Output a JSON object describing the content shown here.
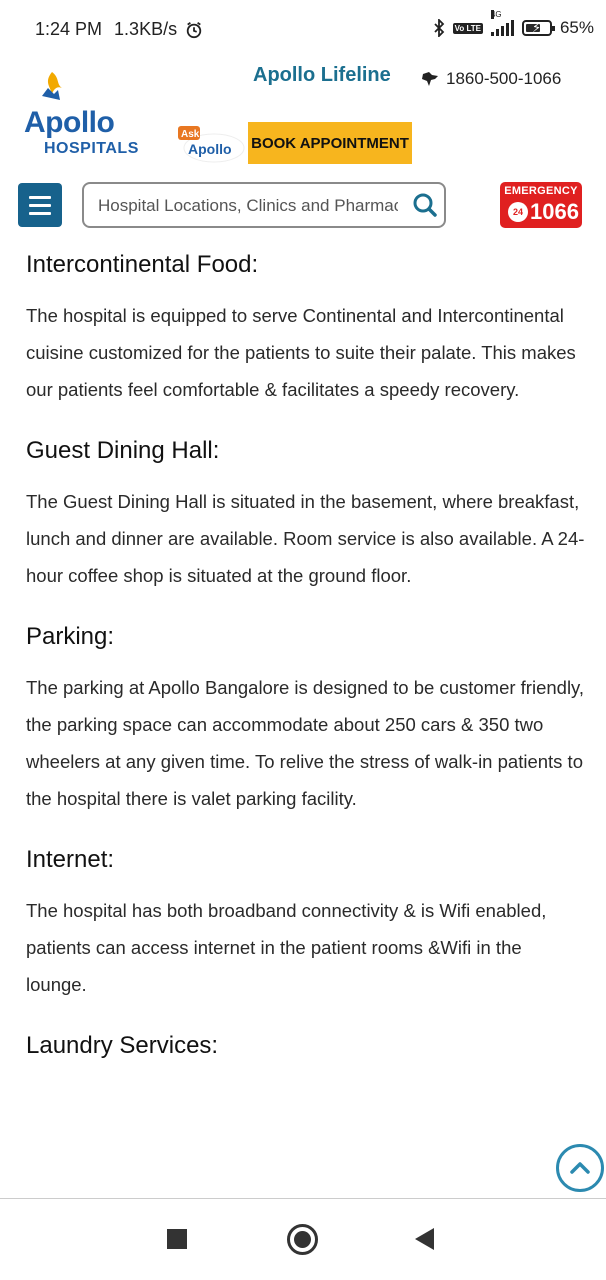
{
  "status_bar": {
    "time": "1:24 PM",
    "network_speed": "1.3KB/s",
    "volte": "Vo LTE",
    "network_type": "4G",
    "battery": "65%",
    "battery_level": 0.65
  },
  "header": {
    "logo_text": "Apollo",
    "logo_subtext": "HOSPITALS",
    "lifeline_link": "Apollo Lifeline",
    "phone": "1860-500-1066",
    "ask_apollo_top": "Ask",
    "ask_apollo_brand": "Apollo",
    "book_appointment": "BOOK APPOINTMENT",
    "search_placeholder": "Hospital Locations, Clinics and Pharmacies",
    "emergency_label": "EMERGENCY",
    "emergency_badge": "24",
    "emergency_number": "1066"
  },
  "sections": [
    {
      "title": "Intercontinental Food:",
      "body": "The hospital is equipped to serve Continental and Intercontinental cuisine customized for the patients to suite their palate. This makes our patients feel comfortable & facilitates a speedy recovery."
    },
    {
      "title": "Guest Dining Hall:",
      "body": "The Guest Dining Hall is situated in the basement, where breakfast, lunch and dinner are available. Room service is also available. A 24-hour coffee shop is situated at the ground floor."
    },
    {
      "title": "Parking:",
      "body": "The parking at Apollo Bangalore is designed to be customer friendly, the parking space can accommodate about 250 cars & 350 two wheelers at any given time. To relive the stress of walk-in patients to the hospital there is valet parking facility."
    },
    {
      "title": "Internet:",
      "body": "The hospital has both broadband connectivity & is Wifi enabled, patients can access internet in the patient rooms &Wifi in the lounge."
    },
    {
      "title": "Laundry Services:",
      "body": ""
    }
  ],
  "colors": {
    "brand_blue": "#1f5fa8",
    "lifeline_teal": "#1b6f8f",
    "book_yellow": "#f7b51e",
    "emergency_red": "#e02020",
    "menu_blue": "#17628c"
  }
}
